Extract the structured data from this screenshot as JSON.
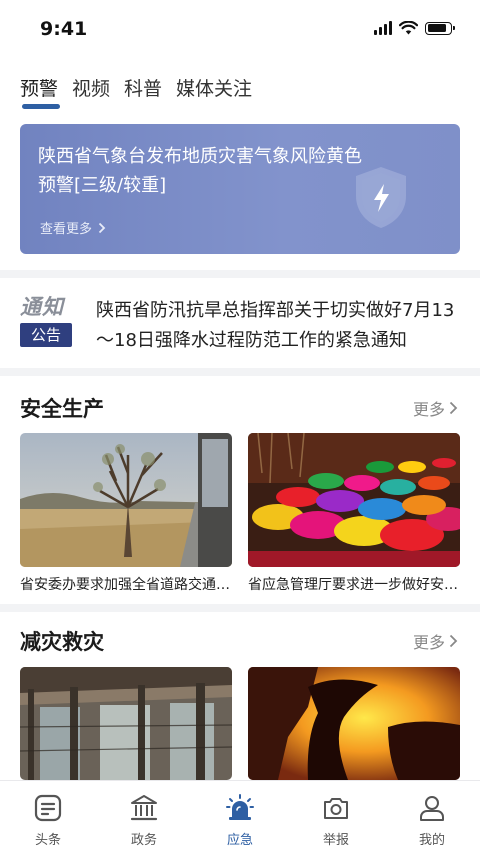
{
  "status_bar": {
    "time": "9:41",
    "battery_level": 0.85
  },
  "tabs": [
    {
      "label": "预警",
      "active": true
    },
    {
      "label": "视频",
      "active": false
    },
    {
      "label": "科普",
      "active": false
    },
    {
      "label": "媒体关注",
      "active": false
    }
  ],
  "banner": {
    "title": "陕西省气象台发布地质灾害气象风险黄色预警[三级/较重]",
    "more_label": "查看更多",
    "icon": "lightning-shield-icon",
    "color": "#7c8dc6"
  },
  "notice": {
    "badge_top": "通知",
    "badge_bottom": "公告",
    "text": "陕西省防汛抗旱总指挥部关于切实做好7月13～18日强降水过程防范工作的紧急通知"
  },
  "sections": [
    {
      "title": "安全生产",
      "more_label": "更多",
      "cards": [
        {
          "caption": "省安委办要求加强全省道路交通安全工作",
          "image": "dry-tree-landscape-image"
        },
        {
          "caption": "省应急管理厅要求进一步做好安全生产工作",
          "image": "colorful-powder-market-image"
        }
      ]
    },
    {
      "title": "减灾救灾",
      "more_label": "更多",
      "cards": [
        {
          "image": "damaged-building-interior-image"
        },
        {
          "image": "silhouette-sunset-image"
        }
      ]
    }
  ],
  "tabbar": [
    {
      "label": "头条",
      "icon": "headline-icon",
      "active": false
    },
    {
      "label": "政务",
      "icon": "government-building-icon",
      "active": false
    },
    {
      "label": "应急",
      "icon": "emergency-siren-icon",
      "active": true
    },
    {
      "label": "举报",
      "icon": "camera-icon",
      "active": false
    },
    {
      "label": "我的",
      "icon": "user-icon",
      "active": false
    }
  ],
  "colors": {
    "accent": "#2e5fa3",
    "notice_badge": "#2f3f7f"
  }
}
